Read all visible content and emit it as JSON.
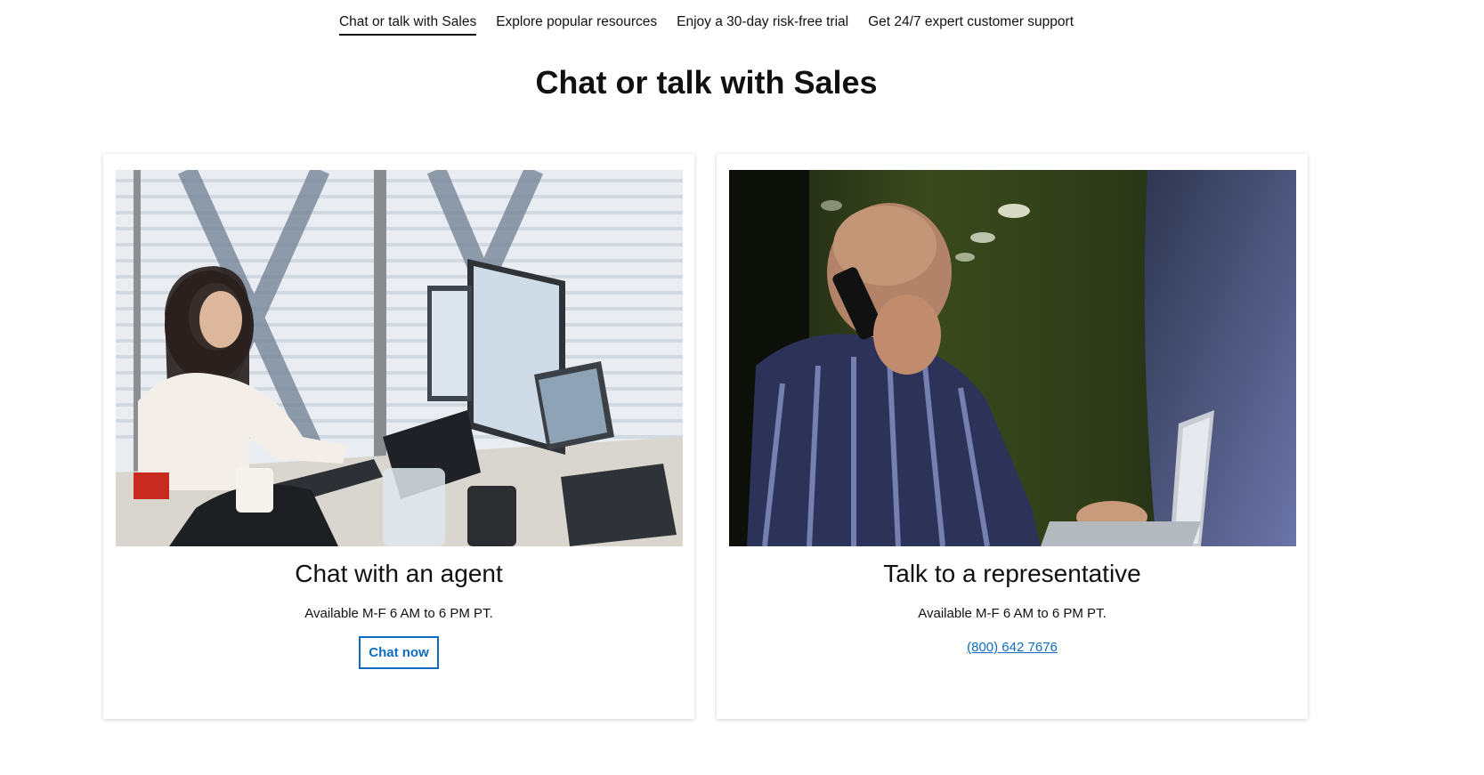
{
  "tabs": [
    {
      "label": "Chat or talk with Sales",
      "active": true
    },
    {
      "label": "Explore popular resources",
      "active": false
    },
    {
      "label": "Enjoy a 30-day risk-free trial",
      "active": false
    },
    {
      "label": "Get 24/7 expert customer support",
      "active": false
    }
  ],
  "section": {
    "title": "Chat or talk with Sales"
  },
  "cards": {
    "chat": {
      "title": "Chat with an agent",
      "availability": "Available M-F 6 AM to 6 PM PT.",
      "button_label": "Chat now",
      "image": "woman-at-computer-photo"
    },
    "talk": {
      "title": "Talk to a representative",
      "availability": "Available M-F 6 AM to 6 PM PT.",
      "phone": "(800) 642 7676",
      "image": "man-on-phone-photo"
    }
  },
  "colors": {
    "link": "#0f6cbd",
    "text": "#111111",
    "background": "#ffffff"
  }
}
